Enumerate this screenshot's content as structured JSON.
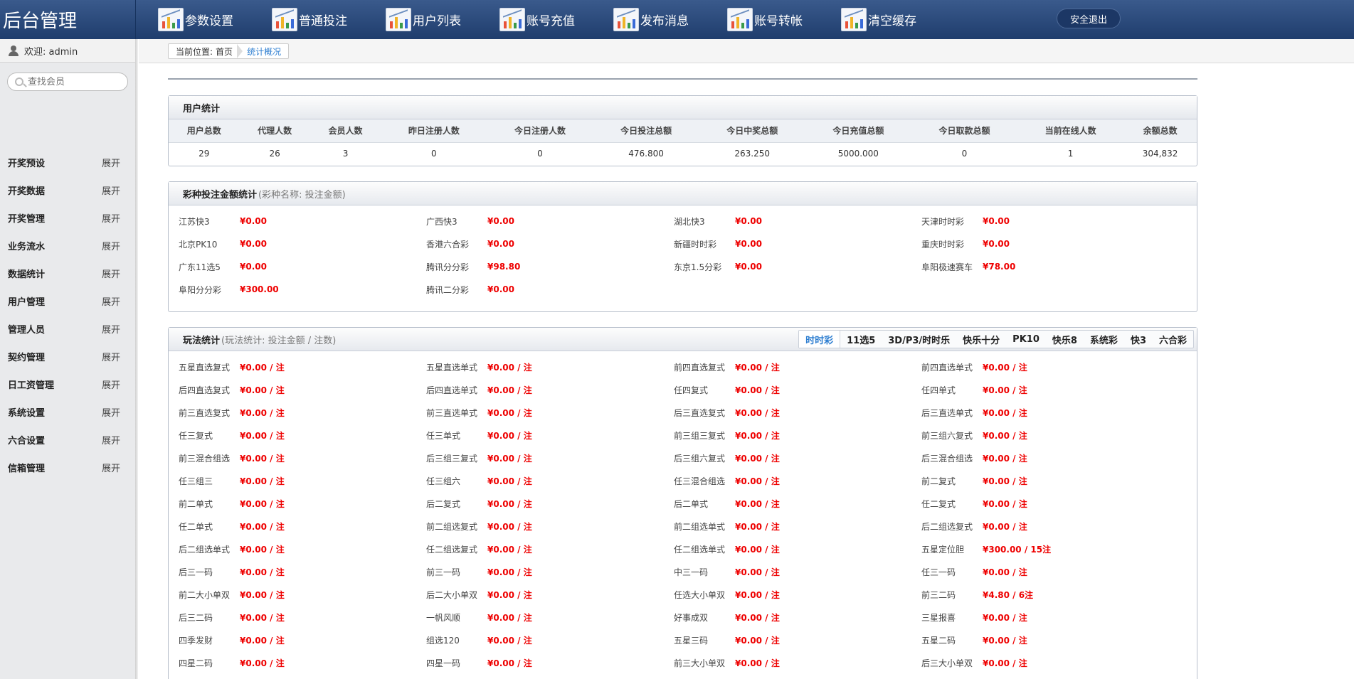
{
  "header": {
    "brand": "后台管理",
    "nav": [
      {
        "label": "参数设置",
        "icon": "chart-icon"
      },
      {
        "label": "普通投注",
        "icon": "chart-icon"
      },
      {
        "label": "用户列表",
        "icon": "chart-icon"
      },
      {
        "label": "账号充值",
        "icon": "chart-icon"
      },
      {
        "label": "发布消息",
        "icon": "chart-icon"
      },
      {
        "label": "账号转帐",
        "icon": "chart-icon"
      },
      {
        "label": "清空缓存",
        "icon": "chart-icon"
      }
    ],
    "logout": "安全退出"
  },
  "sidebar": {
    "welcome": "欢迎: admin",
    "search_placeholder": "查找会员",
    "items": [
      {
        "label": "开奖预设",
        "action": "展开"
      },
      {
        "label": "开奖数据",
        "action": "展开"
      },
      {
        "label": "开奖管理",
        "action": "展开"
      },
      {
        "label": "业务流水",
        "action": "展开"
      },
      {
        "label": "数据统计",
        "action": "展开"
      },
      {
        "label": "用户管理",
        "action": "展开"
      },
      {
        "label": "管理人员",
        "action": "展开"
      },
      {
        "label": "契约管理",
        "action": "展开"
      },
      {
        "label": "日工资管理",
        "action": "展开"
      },
      {
        "label": "系统设置",
        "action": "展开"
      },
      {
        "label": "六合设置",
        "action": "展开"
      },
      {
        "label": "信箱管理",
        "action": "展开"
      }
    ]
  },
  "breadcrumb": {
    "prefix": "当前位置:",
    "home": "首页",
    "current": "统计概况"
  },
  "user_stats": {
    "title": "用户统计",
    "columns": [
      "用户总数",
      "代理人数",
      "会员人数",
      "昨日注册人数",
      "今日注册人数",
      "今日投注总额",
      "今日中奖总额",
      "今日充值总额",
      "今日取款总额",
      "当前在线人数",
      "余额总数"
    ],
    "values": [
      "29",
      "26",
      "3",
      "0",
      "0",
      "476.800",
      "263.250",
      "5000.000",
      "0",
      "1",
      "304,832"
    ]
  },
  "lottery_stats": {
    "title": "彩种投注金额统计",
    "subtitle": "(彩种名称: 投注金额)",
    "items": [
      {
        "name": "江苏快3",
        "value": "¥0.00"
      },
      {
        "name": "广西快3",
        "value": "¥0.00"
      },
      {
        "name": "湖北快3",
        "value": "¥0.00"
      },
      {
        "name": "天津时时彩",
        "value": "¥0.00"
      },
      {
        "name": "北京PK10",
        "value": "¥0.00"
      },
      {
        "name": "香港六合彩",
        "value": "¥0.00"
      },
      {
        "name": "新疆时时彩",
        "value": "¥0.00"
      },
      {
        "name": "重庆时时彩",
        "value": "¥0.00"
      },
      {
        "name": "广东11选5",
        "value": "¥0.00"
      },
      {
        "name": "腾讯分分彩",
        "value": "¥98.80"
      },
      {
        "name": "东京1.5分彩",
        "value": "¥0.00"
      },
      {
        "name": "阜阳极速赛车",
        "value": "¥78.00"
      },
      {
        "name": "阜阳分分彩",
        "value": "¥300.00"
      },
      {
        "name": "腾讯二分彩",
        "value": "¥0.00"
      }
    ]
  },
  "play_stats": {
    "title": "玩法统计",
    "subtitle": "(玩法统计: 投注金额 / 注数)",
    "tabs": [
      "时时彩",
      "11选5",
      "3D/P3/时时乐",
      "快乐十分",
      "PK10",
      "快乐8",
      "系统彩",
      "快3",
      "六合彩"
    ],
    "active_tab": "时时彩",
    "items": [
      {
        "name": "五星直选复式",
        "value": "¥0.00 / 注"
      },
      {
        "name": "五星直选单式",
        "value": "¥0.00 / 注"
      },
      {
        "name": "前四直选复式",
        "value": "¥0.00 / 注"
      },
      {
        "name": "前四直选单式",
        "value": "¥0.00 / 注"
      },
      {
        "name": "后四直选复式",
        "value": "¥0.00 / 注"
      },
      {
        "name": "后四直选单式",
        "value": "¥0.00 / 注"
      },
      {
        "name": "任四复式",
        "value": "¥0.00 / 注"
      },
      {
        "name": "任四单式",
        "value": "¥0.00 / 注"
      },
      {
        "name": "前三直选复式",
        "value": "¥0.00 / 注"
      },
      {
        "name": "前三直选单式",
        "value": "¥0.00 / 注"
      },
      {
        "name": "后三直选复式",
        "value": "¥0.00 / 注"
      },
      {
        "name": "后三直选单式",
        "value": "¥0.00 / 注"
      },
      {
        "name": "任三复式",
        "value": "¥0.00 / 注"
      },
      {
        "name": "任三单式",
        "value": "¥0.00 / 注"
      },
      {
        "name": "前三组三复式",
        "value": "¥0.00 / 注"
      },
      {
        "name": "前三组六复式",
        "value": "¥0.00 / 注"
      },
      {
        "name": "前三混合组选",
        "value": "¥0.00 / 注"
      },
      {
        "name": "后三组三复式",
        "value": "¥0.00 / 注"
      },
      {
        "name": "后三组六复式",
        "value": "¥0.00 / 注"
      },
      {
        "name": "后三混合组选",
        "value": "¥0.00 / 注"
      },
      {
        "name": "任三组三",
        "value": "¥0.00 / 注"
      },
      {
        "name": "任三组六",
        "value": "¥0.00 / 注"
      },
      {
        "name": "任三混合组选",
        "value": "¥0.00 / 注"
      },
      {
        "name": "前二复式",
        "value": "¥0.00 / 注"
      },
      {
        "name": "前二单式",
        "value": "¥0.00 / 注"
      },
      {
        "name": "后二复式",
        "value": "¥0.00 / 注"
      },
      {
        "name": "后二单式",
        "value": "¥0.00 / 注"
      },
      {
        "name": "任二复式",
        "value": "¥0.00 / 注"
      },
      {
        "name": "任二单式",
        "value": "¥0.00 / 注"
      },
      {
        "name": "前二组选复式",
        "value": "¥0.00 / 注"
      },
      {
        "name": "前二组选单式",
        "value": "¥0.00 / 注"
      },
      {
        "name": "后二组选复式",
        "value": "¥0.00 / 注"
      },
      {
        "name": "后二组选单式",
        "value": "¥0.00 / 注"
      },
      {
        "name": "任二组选复式",
        "value": "¥0.00 / 注"
      },
      {
        "name": "任二组选单式",
        "value": "¥0.00 / 注"
      },
      {
        "name": "五星定位胆",
        "value": "¥300.00 / 15注"
      },
      {
        "name": "后三一码",
        "value": "¥0.00 / 注"
      },
      {
        "name": "前三一码",
        "value": "¥0.00 / 注"
      },
      {
        "name": "中三一码",
        "value": "¥0.00 / 注"
      },
      {
        "name": "任三一码",
        "value": "¥0.00 / 注"
      },
      {
        "name": "前二大小单双",
        "value": "¥0.00 / 注"
      },
      {
        "name": "后二大小单双",
        "value": "¥0.00 / 注"
      },
      {
        "name": "任选大小单双",
        "value": "¥0.00 / 注"
      },
      {
        "name": "前三二码",
        "value": "¥4.80 / 6注"
      },
      {
        "name": "后三二码",
        "value": "¥0.00 / 注"
      },
      {
        "name": "一帆风顺",
        "value": "¥0.00 / 注"
      },
      {
        "name": "好事成双",
        "value": "¥0.00 / 注"
      },
      {
        "name": "三星报喜",
        "value": "¥0.00 / 注"
      },
      {
        "name": "四季发财",
        "value": "¥0.00 / 注"
      },
      {
        "name": "组选120",
        "value": "¥0.00 / 注"
      },
      {
        "name": "五星三码",
        "value": "¥0.00 / 注"
      },
      {
        "name": "五星二码",
        "value": "¥0.00 / 注"
      },
      {
        "name": "四星二码",
        "value": "¥0.00 / 注"
      },
      {
        "name": "四星一码",
        "value": "¥0.00 / 注"
      },
      {
        "name": "前三大小单双",
        "value": "¥0.00 / 注"
      },
      {
        "name": "后三大小单双",
        "value": "¥0.00 / 注"
      }
    ]
  },
  "colors": {
    "header_top": "#3a5a8c",
    "header_bottom": "#1f3d6d",
    "money_red": "#e00000",
    "link_blue": "#2f7fd1",
    "sidebar_bg": "#e9eaec"
  }
}
